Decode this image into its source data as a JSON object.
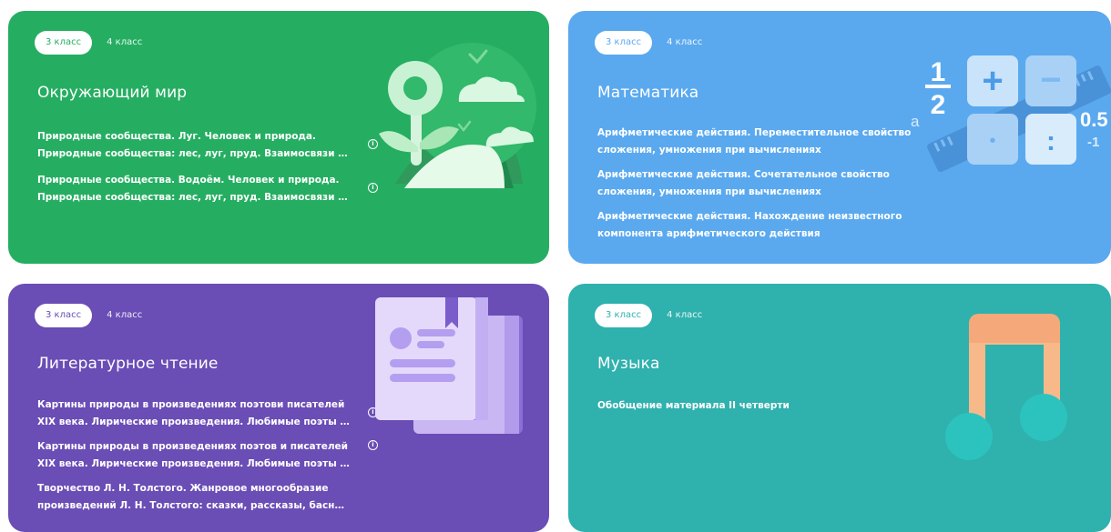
{
  "cards": [
    {
      "color": "#25AE61",
      "tab_active": "3 класс",
      "tab_other": "4 класс",
      "title": "Окружающий мир",
      "topics": [
        {
          "line1": "Природные сообщества. Луг. Человек и природа.",
          "line2": "Природные сообщества: лес, луг, пруд. Взаимосвязи в..."
        },
        {
          "line1": "Природные сообщества. Водоём. Человек и природа.",
          "line2": "Природные сообщества: лес, луг, пруд. Взаимосвязи в..."
        }
      ],
      "icon": "flower-plant-illustration"
    },
    {
      "color": "#5AA9EF",
      "tab_active": "3 класс",
      "tab_other": "4 класс",
      "title": "Математика",
      "topics": [
        {
          "line1": "Арифметические действия. Переместительное свойство",
          "line2": "сложения, умножения при вычислениях"
        },
        {
          "line1": "Арифметические действия. Сочетательное свойство",
          "line2": "сложения, умножения при вычислениях"
        },
        {
          "line1": "Арифметические действия. Нахождение неизвестного",
          "line2": "компонента арифметического действия"
        }
      ],
      "math_symbols": {
        "half_num": "1",
        "half_den": "2",
        "plus": "+",
        "minus": "−",
        "dot": "•",
        "colon": ":",
        "a": "a",
        "decimal": "0.5",
        "neg": "-1"
      },
      "icon": "math-calculator-illustration"
    },
    {
      "color": "#6A4DB5",
      "tab_active": "3 класс",
      "tab_other": "4 класс",
      "title": "Литературное чтение",
      "topics": [
        {
          "line1": "Картины природы в произведениях поэтови писателей",
          "line2": "XIX века. Лирические произведения. Любимые поэты Х..."
        },
        {
          "line1": "Картины природы в произведениях поэтов и писателей",
          "line2": "XIX века. Лирические произведения. Любимые поэты Х..."
        },
        {
          "line1": "Творчество Л. Н. Толстого. Жанровое многообразие",
          "line2": "произведений Л. Н. Толстого: сказки, рассказы, басни, быль"
        }
      ],
      "icon": "books-illustration"
    },
    {
      "color": "#2FB1AE",
      "tab_active": "3 класс",
      "tab_other": "4 класс",
      "title": "Музыка",
      "topics": [
        {
          "line1": "Обобщение материала II четверти",
          "line2": ""
        }
      ],
      "icon": "music-note-illustration"
    }
  ]
}
